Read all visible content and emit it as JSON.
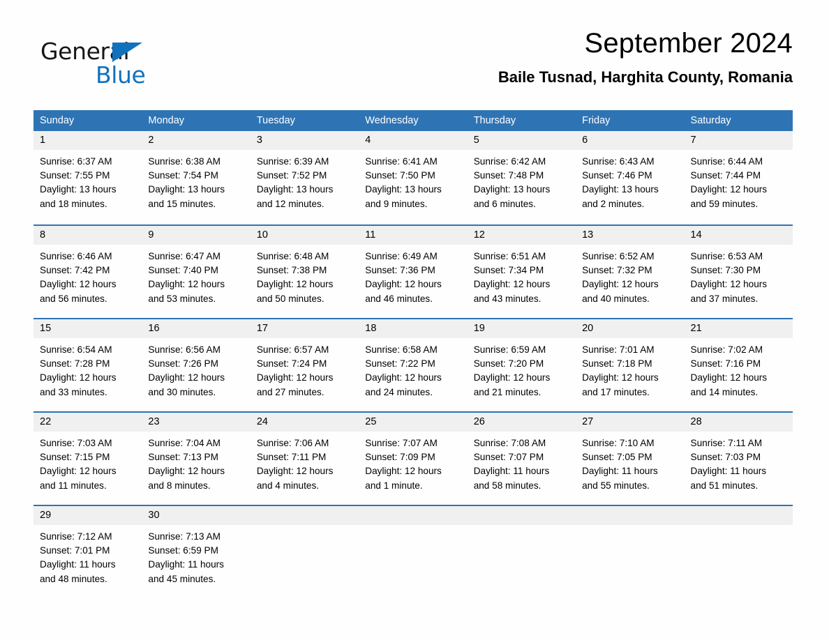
{
  "brand": {
    "name_part1": "General",
    "name_part2": "Blue",
    "accent_color": "#1271bd"
  },
  "header": {
    "title": "September 2024",
    "subtitle": "Baile Tusnad, Harghita County, Romania"
  },
  "calendar": {
    "header_color": "#2e74b5",
    "daynum_band_color": "#f0f0f0",
    "weekdays": [
      "Sunday",
      "Monday",
      "Tuesday",
      "Wednesday",
      "Thursday",
      "Friday",
      "Saturday"
    ],
    "weeks": [
      [
        {
          "day": "1",
          "sunrise": "Sunrise: 6:37 AM",
          "sunset": "Sunset: 7:55 PM",
          "daylight_line1": "Daylight: 13 hours",
          "daylight_line2": "and 18 minutes."
        },
        {
          "day": "2",
          "sunrise": "Sunrise: 6:38 AM",
          "sunset": "Sunset: 7:54 PM",
          "daylight_line1": "Daylight: 13 hours",
          "daylight_line2": "and 15 minutes."
        },
        {
          "day": "3",
          "sunrise": "Sunrise: 6:39 AM",
          "sunset": "Sunset: 7:52 PM",
          "daylight_line1": "Daylight: 13 hours",
          "daylight_line2": "and 12 minutes."
        },
        {
          "day": "4",
          "sunrise": "Sunrise: 6:41 AM",
          "sunset": "Sunset: 7:50 PM",
          "daylight_line1": "Daylight: 13 hours",
          "daylight_line2": "and 9 minutes."
        },
        {
          "day": "5",
          "sunrise": "Sunrise: 6:42 AM",
          "sunset": "Sunset: 7:48 PM",
          "daylight_line1": "Daylight: 13 hours",
          "daylight_line2": "and 6 minutes."
        },
        {
          "day": "6",
          "sunrise": "Sunrise: 6:43 AM",
          "sunset": "Sunset: 7:46 PM",
          "daylight_line1": "Daylight: 13 hours",
          "daylight_line2": "and 2 minutes."
        },
        {
          "day": "7",
          "sunrise": "Sunrise: 6:44 AM",
          "sunset": "Sunset: 7:44 PM",
          "daylight_line1": "Daylight: 12 hours",
          "daylight_line2": "and 59 minutes."
        }
      ],
      [
        {
          "day": "8",
          "sunrise": "Sunrise: 6:46 AM",
          "sunset": "Sunset: 7:42 PM",
          "daylight_line1": "Daylight: 12 hours",
          "daylight_line2": "and 56 minutes."
        },
        {
          "day": "9",
          "sunrise": "Sunrise: 6:47 AM",
          "sunset": "Sunset: 7:40 PM",
          "daylight_line1": "Daylight: 12 hours",
          "daylight_line2": "and 53 minutes."
        },
        {
          "day": "10",
          "sunrise": "Sunrise: 6:48 AM",
          "sunset": "Sunset: 7:38 PM",
          "daylight_line1": "Daylight: 12 hours",
          "daylight_line2": "and 50 minutes."
        },
        {
          "day": "11",
          "sunrise": "Sunrise: 6:49 AM",
          "sunset": "Sunset: 7:36 PM",
          "daylight_line1": "Daylight: 12 hours",
          "daylight_line2": "and 46 minutes."
        },
        {
          "day": "12",
          "sunrise": "Sunrise: 6:51 AM",
          "sunset": "Sunset: 7:34 PM",
          "daylight_line1": "Daylight: 12 hours",
          "daylight_line2": "and 43 minutes."
        },
        {
          "day": "13",
          "sunrise": "Sunrise: 6:52 AM",
          "sunset": "Sunset: 7:32 PM",
          "daylight_line1": "Daylight: 12 hours",
          "daylight_line2": "and 40 minutes."
        },
        {
          "day": "14",
          "sunrise": "Sunrise: 6:53 AM",
          "sunset": "Sunset: 7:30 PM",
          "daylight_line1": "Daylight: 12 hours",
          "daylight_line2": "and 37 minutes."
        }
      ],
      [
        {
          "day": "15",
          "sunrise": "Sunrise: 6:54 AM",
          "sunset": "Sunset: 7:28 PM",
          "daylight_line1": "Daylight: 12 hours",
          "daylight_line2": "and 33 minutes."
        },
        {
          "day": "16",
          "sunrise": "Sunrise: 6:56 AM",
          "sunset": "Sunset: 7:26 PM",
          "daylight_line1": "Daylight: 12 hours",
          "daylight_line2": "and 30 minutes."
        },
        {
          "day": "17",
          "sunrise": "Sunrise: 6:57 AM",
          "sunset": "Sunset: 7:24 PM",
          "daylight_line1": "Daylight: 12 hours",
          "daylight_line2": "and 27 minutes."
        },
        {
          "day": "18",
          "sunrise": "Sunrise: 6:58 AM",
          "sunset": "Sunset: 7:22 PM",
          "daylight_line1": "Daylight: 12 hours",
          "daylight_line2": "and 24 minutes."
        },
        {
          "day": "19",
          "sunrise": "Sunrise: 6:59 AM",
          "sunset": "Sunset: 7:20 PM",
          "daylight_line1": "Daylight: 12 hours",
          "daylight_line2": "and 21 minutes."
        },
        {
          "day": "20",
          "sunrise": "Sunrise: 7:01 AM",
          "sunset": "Sunset: 7:18 PM",
          "daylight_line1": "Daylight: 12 hours",
          "daylight_line2": "and 17 minutes."
        },
        {
          "day": "21",
          "sunrise": "Sunrise: 7:02 AM",
          "sunset": "Sunset: 7:16 PM",
          "daylight_line1": "Daylight: 12 hours",
          "daylight_line2": "and 14 minutes."
        }
      ],
      [
        {
          "day": "22",
          "sunrise": "Sunrise: 7:03 AM",
          "sunset": "Sunset: 7:15 PM",
          "daylight_line1": "Daylight: 12 hours",
          "daylight_line2": "and 11 minutes."
        },
        {
          "day": "23",
          "sunrise": "Sunrise: 7:04 AM",
          "sunset": "Sunset: 7:13 PM",
          "daylight_line1": "Daylight: 12 hours",
          "daylight_line2": "and 8 minutes."
        },
        {
          "day": "24",
          "sunrise": "Sunrise: 7:06 AM",
          "sunset": "Sunset: 7:11 PM",
          "daylight_line1": "Daylight: 12 hours",
          "daylight_line2": "and 4 minutes."
        },
        {
          "day": "25",
          "sunrise": "Sunrise: 7:07 AM",
          "sunset": "Sunset: 7:09 PM",
          "daylight_line1": "Daylight: 12 hours",
          "daylight_line2": "and 1 minute."
        },
        {
          "day": "26",
          "sunrise": "Sunrise: 7:08 AM",
          "sunset": "Sunset: 7:07 PM",
          "daylight_line1": "Daylight: 11 hours",
          "daylight_line2": "and 58 minutes."
        },
        {
          "day": "27",
          "sunrise": "Sunrise: 7:10 AM",
          "sunset": "Sunset: 7:05 PM",
          "daylight_line1": "Daylight: 11 hours",
          "daylight_line2": "and 55 minutes."
        },
        {
          "day": "28",
          "sunrise": "Sunrise: 7:11 AM",
          "sunset": "Sunset: 7:03 PM",
          "daylight_line1": "Daylight: 11 hours",
          "daylight_line2": "and 51 minutes."
        }
      ],
      [
        {
          "day": "29",
          "sunrise": "Sunrise: 7:12 AM",
          "sunset": "Sunset: 7:01 PM",
          "daylight_line1": "Daylight: 11 hours",
          "daylight_line2": "and 48 minutes."
        },
        {
          "day": "30",
          "sunrise": "Sunrise: 7:13 AM",
          "sunset": "Sunset: 6:59 PM",
          "daylight_line1": "Daylight: 11 hours",
          "daylight_line2": "and 45 minutes."
        },
        {
          "day": "",
          "sunrise": "",
          "sunset": "",
          "daylight_line1": "",
          "daylight_line2": ""
        },
        {
          "day": "",
          "sunrise": "",
          "sunset": "",
          "daylight_line1": "",
          "daylight_line2": ""
        },
        {
          "day": "",
          "sunrise": "",
          "sunset": "",
          "daylight_line1": "",
          "daylight_line2": ""
        },
        {
          "day": "",
          "sunrise": "",
          "sunset": "",
          "daylight_line1": "",
          "daylight_line2": ""
        },
        {
          "day": "",
          "sunrise": "",
          "sunset": "",
          "daylight_line1": "",
          "daylight_line2": ""
        }
      ]
    ]
  }
}
